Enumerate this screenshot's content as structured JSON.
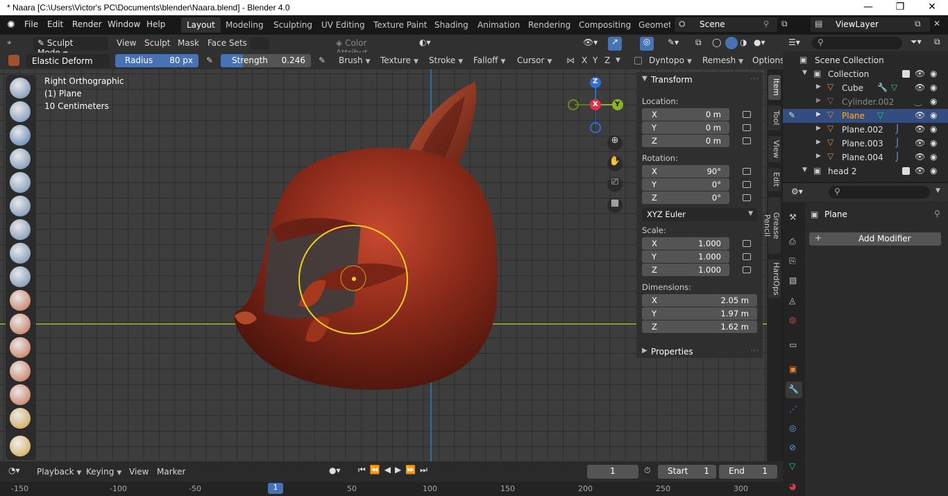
{
  "window": {
    "title": "* Naara [C:\\Users\\Victor's PC\\Documents\\blender\\Naara.blend] - Blender 4.0",
    "controls": [
      "—",
      "❐",
      "✕"
    ]
  },
  "menu": [
    "File",
    "Edit",
    "Render",
    "Window",
    "Help"
  ],
  "workspaces": [
    "Layout",
    "Modeling",
    "Sculpting",
    "UV Editing",
    "Texture Paint",
    "Shading",
    "Animation",
    "Rendering",
    "Compositing",
    "Geomet"
  ],
  "active_workspace": "Layout",
  "scene": "Scene",
  "view_layer": "ViewLayer",
  "header": {
    "mode": "Sculpt Mode",
    "menus": [
      "View",
      "Sculpt",
      "Mask",
      "Face Sets"
    ],
    "color_attribute": "Color Attribut..."
  },
  "tool_settings": {
    "brush": "Elastic Deform",
    "radius_label": "Radius",
    "radius_value": "80 px",
    "strength_label": "Strength",
    "strength_value": "0.246",
    "menus": [
      "Brush",
      "Texture",
      "Stroke",
      "Falloff",
      "Cursor"
    ],
    "axes": [
      "X",
      "Y",
      "Z"
    ],
    "dyntopo": "Dyntopo",
    "remesh": "Remesh",
    "options": "Options"
  },
  "viewport": {
    "view_name": "Right Orthographic",
    "object": "(1) Plane",
    "scale": "10 Centimeters",
    "gizmo": {
      "z": "Z",
      "x": "X",
      "y": "Y"
    }
  },
  "transform": {
    "title": "Transform",
    "location_label": "Location:",
    "location": [
      {
        "k": "X",
        "v": "0 m"
      },
      {
        "k": "Y",
        "v": "0 m"
      },
      {
        "k": "Z",
        "v": "0 m"
      }
    ],
    "rotation_label": "Rotation:",
    "rotation": [
      {
        "k": "X",
        "v": "90°"
      },
      {
        "k": "Y",
        "v": "0°"
      },
      {
        "k": "Z",
        "v": "0°"
      }
    ],
    "rotation_mode": "XYZ Euler",
    "scale_label": "Scale:",
    "scale": [
      {
        "k": "X",
        "v": "1.000"
      },
      {
        "k": "Y",
        "v": "1.000"
      },
      {
        "k": "Z",
        "v": "1.000"
      }
    ],
    "dimensions_label": "Dimensions:",
    "dimensions": [
      {
        "k": "X",
        "v": "2.05 m"
      },
      {
        "k": "Y",
        "v": "1.97 m"
      },
      {
        "k": "Z",
        "v": "1.62 m"
      }
    ],
    "properties": "Properties"
  },
  "side_tabs": [
    "Item",
    "Tool",
    "View",
    "Edit",
    "Grease Pencil",
    "HardOps"
  ],
  "timeline": {
    "menus": [
      "Playback",
      "Keying",
      "View",
      "Marker"
    ],
    "current_frame": "1",
    "start_label": "Start",
    "start": "1",
    "end_label": "End",
    "end": "1",
    "ruler": [
      "-150",
      "-100",
      "-50",
      "1",
      "50",
      "100",
      "150",
      "200",
      "250",
      "300"
    ]
  },
  "outliner": {
    "root": "Scene Collection",
    "items": [
      {
        "name": "Collection",
        "level": 1
      },
      {
        "name": "Cube",
        "level": 2
      },
      {
        "name": "Cylinder.002",
        "level": 2
      },
      {
        "name": "Plane",
        "level": 2
      },
      {
        "name": "Plane.002",
        "level": 2
      },
      {
        "name": "Plane.003",
        "level": 2
      },
      {
        "name": "Plane.004",
        "level": 2
      },
      {
        "name": "head 2",
        "level": 1
      }
    ]
  },
  "properties": {
    "object": "Plane",
    "add_modifier": "Add Modifier"
  },
  "colors": {
    "accent": "#4772b3",
    "selection": "#334d80",
    "active_text": "#ffaf29",
    "brush_circle": "#f2d21e"
  }
}
